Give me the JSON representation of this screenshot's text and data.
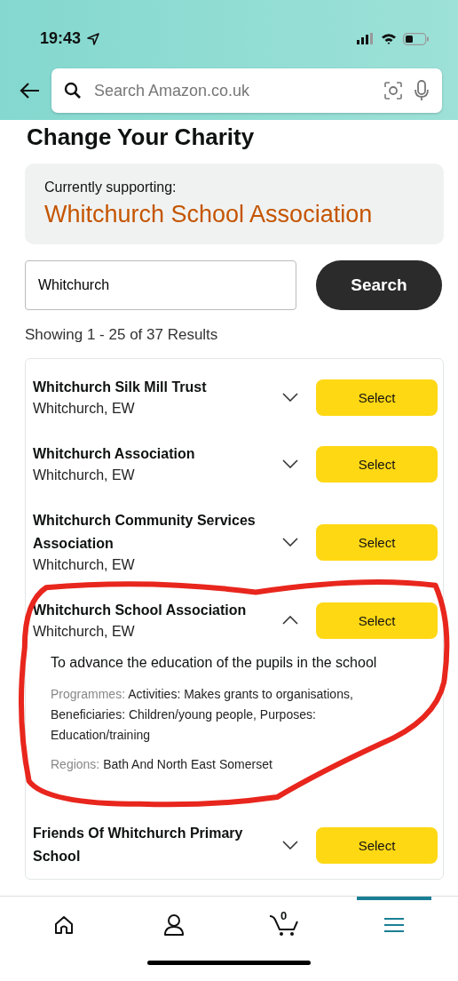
{
  "status_bar": {
    "time": "19:43"
  },
  "header": {
    "search_placeholder": "Search Amazon.co.uk"
  },
  "title": "Change Your Charity",
  "current": {
    "label": "Currently supporting:",
    "charity": "Whitchurch School Association"
  },
  "charity_search": {
    "value": "Whitchurch",
    "button": "Search"
  },
  "results_count": "Showing 1 - 25 of 37 Results",
  "charities": [
    {
      "name": "Whitchurch Silk Mill Trust",
      "location": "Whitchurch, EW",
      "expanded": false,
      "button": "Select"
    },
    {
      "name": "Whitchurch Association",
      "location": "Whitchurch, EW",
      "expanded": false,
      "button": "Select"
    },
    {
      "name": "Whitchurch Community Services Association",
      "location": "Whitchurch, EW",
      "expanded": false,
      "button": "Select"
    },
    {
      "name": "Whitchurch School Association",
      "location": "Whitchurch, EW",
      "expanded": true,
      "button": "Select",
      "annotated": true,
      "description": "To advance the education of the pupils in the school",
      "details": [
        {
          "label": "Programmes:",
          "value": "Activities: Makes grants to organisations, Beneficiaries: Children/young people, Purposes: Education/training"
        },
        {
          "label": "Regions:",
          "value": "Bath And North East Somerset"
        }
      ]
    },
    {
      "name": "Friends Of Whitchurch Primary School",
      "expanded": false,
      "button": "Select"
    }
  ],
  "bottom_nav": [
    {
      "kind": "home",
      "selected": false
    },
    {
      "kind": "account",
      "selected": false
    },
    {
      "kind": "cart",
      "count": "0",
      "selected": false
    },
    {
      "kind": "menu",
      "selected": true
    }
  ]
}
